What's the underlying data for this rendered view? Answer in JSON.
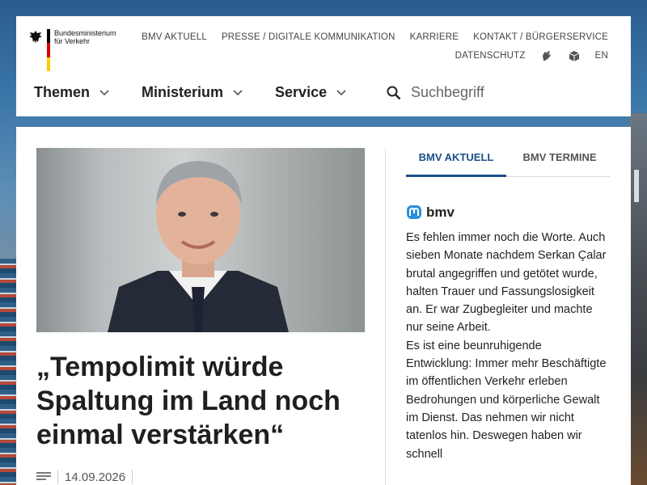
{
  "logo": {
    "line1": "Bundesministerium",
    "line2": "für Verkehr"
  },
  "topnav": {
    "row1": [
      "BMV AKTUELL",
      "PRESSE / DIGITALE KOMMUNIKATION",
      "KARRIERE",
      "KONTAKT / BÜRGERSERVICE"
    ],
    "row2": {
      "datenschutz": "DATENSCHUTZ",
      "lang": "EN"
    }
  },
  "mainnav": [
    "Themen",
    "Ministerium",
    "Service"
  ],
  "search": {
    "placeholder": "Suchbegriff"
  },
  "article": {
    "headline": "„Tempolimit würde Spaltung im Land noch einmal verstärken“",
    "date": "14.09.2026"
  },
  "sidebar": {
    "tabs": [
      "BMV AKTUELL",
      "BMV TERMINE"
    ],
    "active_tab": "BMV AKTUELL",
    "feed_account": "bmv",
    "feed_paragraph1": "Es fehlen immer noch die Worte. Auch sieben Monate nachdem Serkan Çalar brutal angegriffen und getötet wurde, halten Trauer und Fassungslosigkeit an. Er war Zugbegleiter und machte nur seine Arbeit.",
    "feed_paragraph2": "Es ist eine beunruhigende Entwicklung: Immer mehr Beschäftigte im öffentlichen Verkehr erleben Bedrohungen und körperliche Gewalt im Dienst. Das nehmen wir nicht tatenlos hin. Deswegen haben wir schnell"
  },
  "colors": {
    "accent": "#1a4f8b",
    "mastodon": "#2b90d9",
    "flag": [
      "#000000",
      "#dd0000",
      "#ffcc00"
    ]
  },
  "icons": [
    "eagle-icon",
    "sign-language-icon",
    "easy-language-icon",
    "chevron-down-icon",
    "search-icon",
    "mastodon-icon",
    "article-icon"
  ]
}
